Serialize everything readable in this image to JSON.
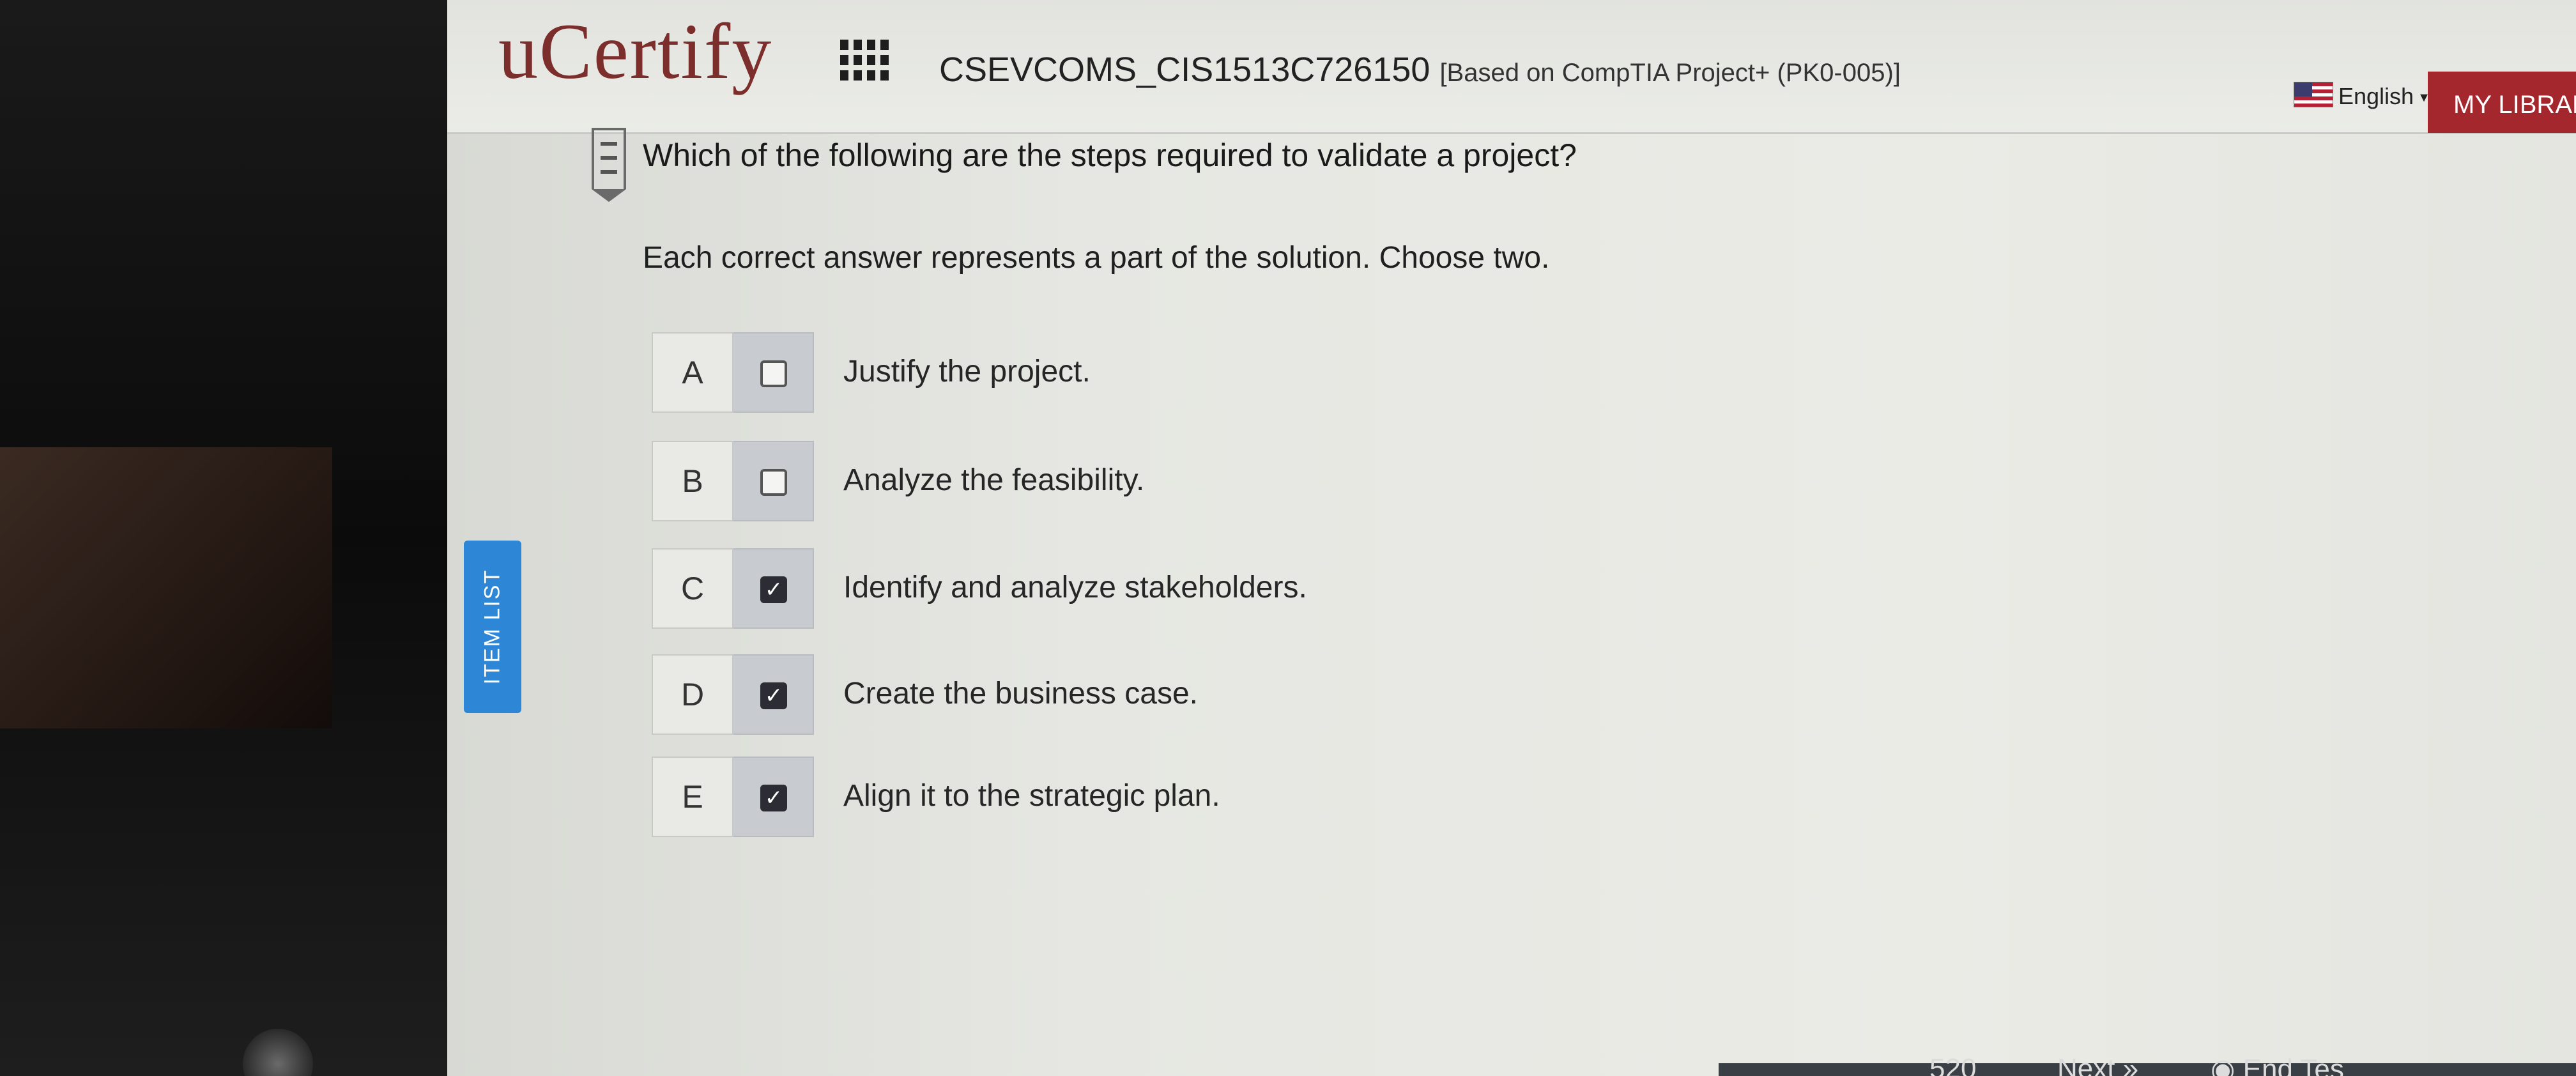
{
  "header": {
    "logo": "uCertify",
    "course_code": "CSEVCOMS_CIS1513C726150",
    "course_subtitle": "[Based on CompTIA Project+ (PK0-005)]",
    "language": "English",
    "my_library": "MY LIBRARY"
  },
  "sidebar": {
    "item_list": "ITEM LIST"
  },
  "question": {
    "text": "Which of the following are the steps required to validate a project?",
    "instruction": "Each correct answer represents a part of the solution. Choose two.",
    "options": [
      {
        "letter": "A",
        "text": "Justify the project.",
        "checked": false
      },
      {
        "letter": "B",
        "text": "Analyze the feasibility.",
        "checked": false
      },
      {
        "letter": "C",
        "text": "Identify and analyze stakeholders.",
        "checked": true
      },
      {
        "letter": "D",
        "text": "Create the business case.",
        "checked": true
      },
      {
        "letter": "E",
        "text": "Align it to the strategic plan.",
        "checked": true
      }
    ]
  },
  "footer": {
    "timer": "520",
    "next": "Next",
    "end_test": "End Tes"
  }
}
